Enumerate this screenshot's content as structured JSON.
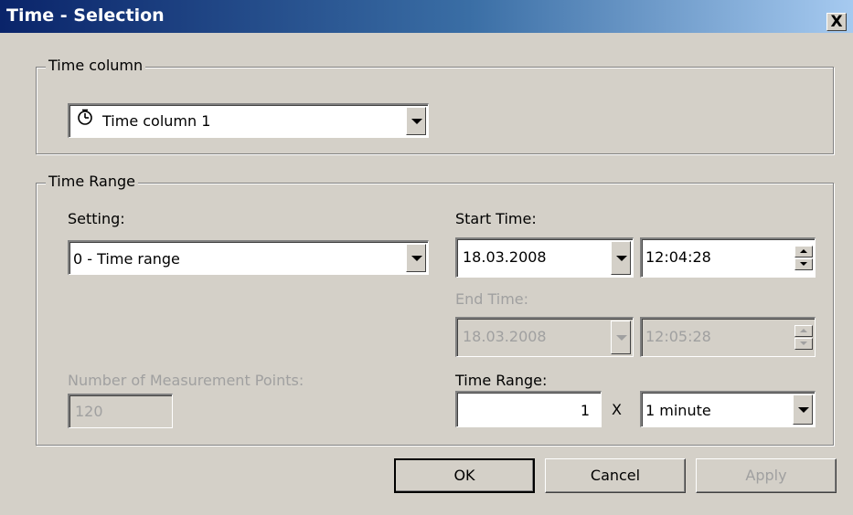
{
  "window": {
    "title": "Time - Selection",
    "close_label": "X"
  },
  "time_column_group": {
    "legend": "Time column",
    "selected": "Time column 1",
    "icon": "clock-icon"
  },
  "time_range_group": {
    "legend": "Time Range",
    "setting_label": "Setting:",
    "setting_value": "0 - Time range",
    "start_time_label": "Start Time:",
    "start_date": "18.03.2008",
    "start_time": "12:04:28",
    "end_time_label": "End Time:",
    "end_date": "18.03.2008",
    "end_time": "12:05:28",
    "points_label": "Number of Measurement Points:",
    "points_value": "120",
    "range_label": "Time Range:",
    "range_count": "1",
    "range_multiplier": "X",
    "range_unit": "1 minute"
  },
  "buttons": {
    "ok": "OK",
    "cancel": "Cancel",
    "apply": "Apply"
  }
}
